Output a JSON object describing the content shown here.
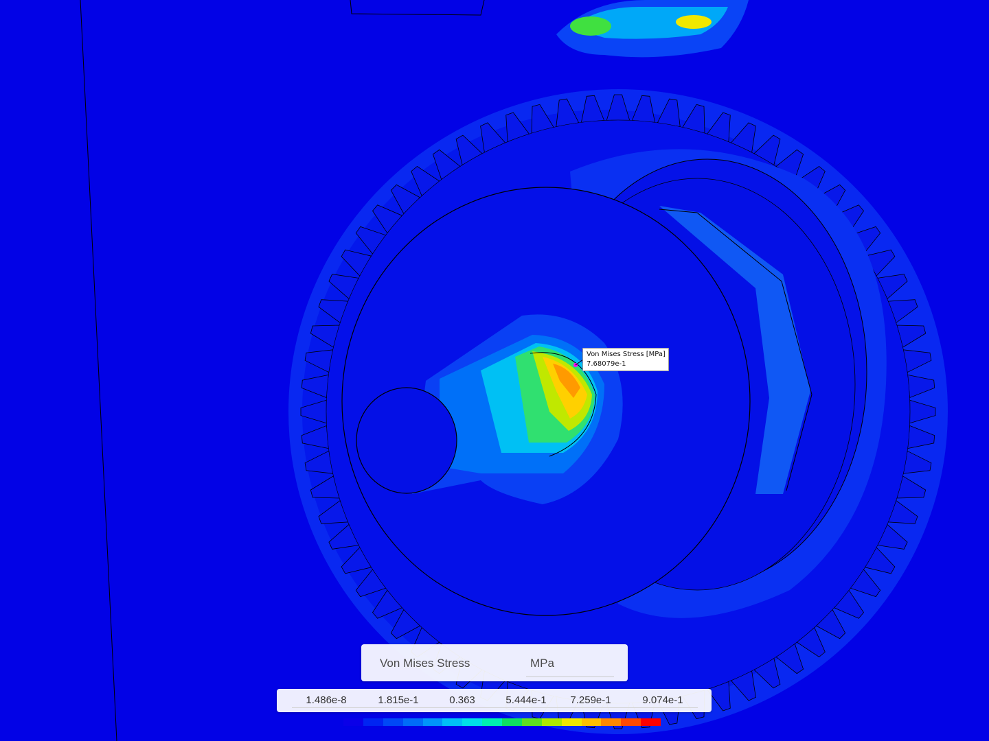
{
  "probe": {
    "label": "Von Mises Stress [MPa]",
    "value": "7.68079e-1"
  },
  "legend": {
    "title": "Von Mises Stress",
    "unit": "MPa",
    "ticks": [
      "1.486e-8",
      "1.815e-1",
      "0.363",
      "5.444e-1",
      "7.259e-1",
      "9.074e-1"
    ],
    "colors": [
      "#0a00e8",
      "#0024f2",
      "#0048f6",
      "#006cf8",
      "#0094fa",
      "#00c0f6",
      "#00e0e8",
      "#00f0b0",
      "#10e060",
      "#60e020",
      "#b0e800",
      "#f0e800",
      "#ffc000",
      "#ff8800",
      "#ff4a00",
      "#ff0000"
    ]
  },
  "colors": {
    "background": "#0202e6",
    "outline": "#000000",
    "probe_marker": "#ff00ff"
  }
}
